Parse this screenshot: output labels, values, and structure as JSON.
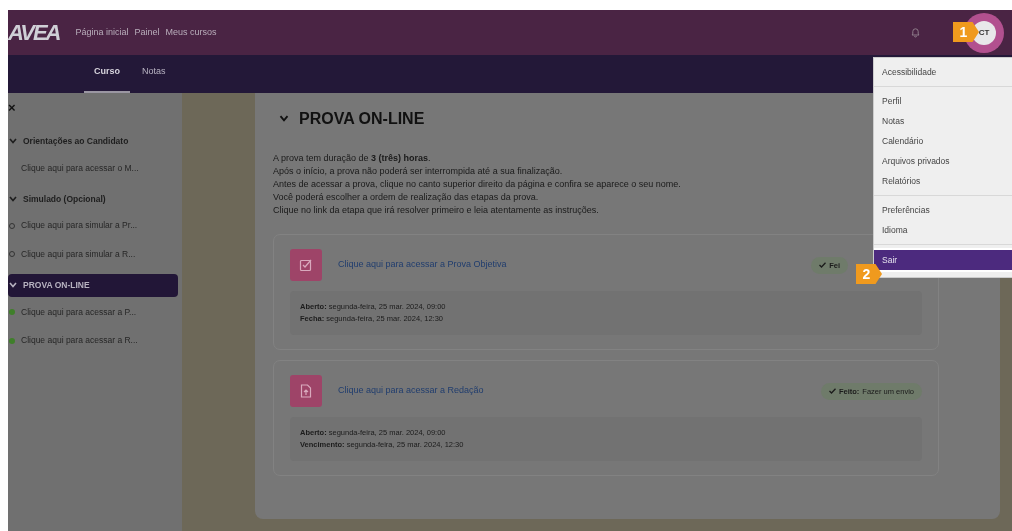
{
  "navbar": {
    "logo": "AVEA",
    "links": [
      "Página inicial",
      "Painel",
      "Meus cursos"
    ],
    "avatar": "CT"
  },
  "callouts": [
    "1",
    "2"
  ],
  "tabs": [
    {
      "label": "Curso",
      "selected": true
    },
    {
      "label": "Notas",
      "selected": false
    }
  ],
  "user_menu": [
    [
      {
        "label": "Acessibilidade",
        "selected": false
      }
    ],
    [
      {
        "label": "Perfil",
        "selected": false
      },
      {
        "label": "Notas",
        "selected": false
      },
      {
        "label": "Calendário",
        "selected": false
      },
      {
        "label": "Arquivos privados",
        "selected": false
      },
      {
        "label": "Relatórios",
        "selected": false
      }
    ],
    [
      {
        "label": "Preferências",
        "selected": false
      },
      {
        "label": "Idioma",
        "selected": false
      }
    ],
    [
      {
        "label": "Sair",
        "selected": true
      }
    ]
  ],
  "sidebar": {
    "close": "×",
    "sections": [
      {
        "title": "Orientações ao Candidato",
        "expanded": true,
        "selected": false,
        "items": [
          {
            "label": "Clique aqui para acessar o M...",
            "kind": "plain"
          }
        ]
      },
      {
        "title": "Simulado (Opcional)",
        "expanded": true,
        "selected": false,
        "items": [
          {
            "label": "Clique aqui para simular a Pr...",
            "kind": "pending"
          },
          {
            "label": "Clique aqui para simular a R...",
            "kind": "pending"
          }
        ]
      },
      {
        "title": "PROVA ON-LINE",
        "expanded": true,
        "selected": true,
        "items": [
          {
            "label": "Clique aqui para acessar a P...",
            "kind": "complete"
          },
          {
            "label": "Clique aqui para acessar a R...",
            "kind": "complete"
          }
        ]
      }
    ]
  },
  "main": {
    "title": "PROVA ON-LINE",
    "expanded": true,
    "intro": [
      "A prova tem duração de **3 (três) horas**.",
      "Após o início, a prova não poderá ser interrompida até a sua finalização.",
      "Antes de acessar a prova, clique no canto superior direito da página e confira se aparece o seu nome.",
      "Você poderá escolher a ordem de realização das etapas da prova.",
      "Clique no link da etapa que irá resolver primeiro e leia atentamente as instruções."
    ],
    "activities": [
      {
        "kind": "quiz",
        "link": "Clique aqui para acessar a Prova Objetiva",
        "badge": {
          "label": "Fei"
        },
        "dates": [
          {
            "label": "Aberto:",
            "value": "segunda-feira, 25 mar. 2024, 09:00"
          },
          {
            "label": "Fecha:",
            "value": "segunda-feira, 25 mar. 2024, 12:30"
          }
        ]
      },
      {
        "kind": "assign",
        "link": "Clique aqui para acessar a Redação",
        "badge": {
          "label": "Feito:",
          "value": "Fazer um envio"
        },
        "dates": [
          {
            "label": "Aberto:",
            "value": "segunda-feira, 25 mar. 2024, 09:00"
          },
          {
            "label": "Vencimento:",
            "value": "segunda-feira, 25 mar. 2024, 12:30"
          }
        ]
      }
    ]
  }
}
